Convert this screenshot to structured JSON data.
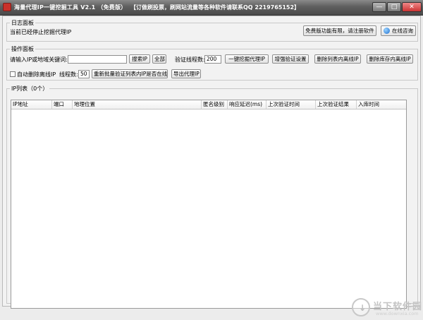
{
  "window": {
    "title": "海量代理IP一键挖掘工具 V2.1 （免费版）",
    "promo": "【订做刷投票，刷网站流量等各种软件请联系QQ 2219765152】",
    "minimize": "—",
    "maximize": "□",
    "close": "✕"
  },
  "log_panel": {
    "title": "日志面板",
    "message": "当前已经停止挖掘代理IP",
    "register_button": "免费版功能有限，请注册软件",
    "online_button": "在线咨询"
  },
  "ops_panel": {
    "title": "操作面板",
    "ip_search_label": "请输入IP或地域关键词:",
    "ip_search_value": "",
    "search_button": "搜索IP",
    "all_button": "全部",
    "verify_threads_label": "验证线程数:",
    "verify_threads_value": "200",
    "mine_button": "一键挖掘代理IP",
    "enhance_button": "增强验证设置",
    "delete_list_button": "删除列表内离线IP",
    "delete_db_button": "删除库存内离线IP",
    "auto_delete_label": "自动删除离线IP",
    "thread_label": "线程数:",
    "thread_value": "50",
    "reverify_button": "重新批量验证列表内IP是否在线",
    "export_button": "导出代理IP"
  },
  "ip_list": {
    "title": "IP列表（0个）",
    "columns": [
      "IP地址",
      "端口",
      "地理位置",
      "匿名级别",
      "响应延迟(ms)",
      "上次验证时间",
      "上次验证结果",
      "入库时间"
    ]
  },
  "watermark": {
    "text": "当下软件园",
    "url": "www.downxia.com",
    "icon": "download-arrow-icon"
  }
}
